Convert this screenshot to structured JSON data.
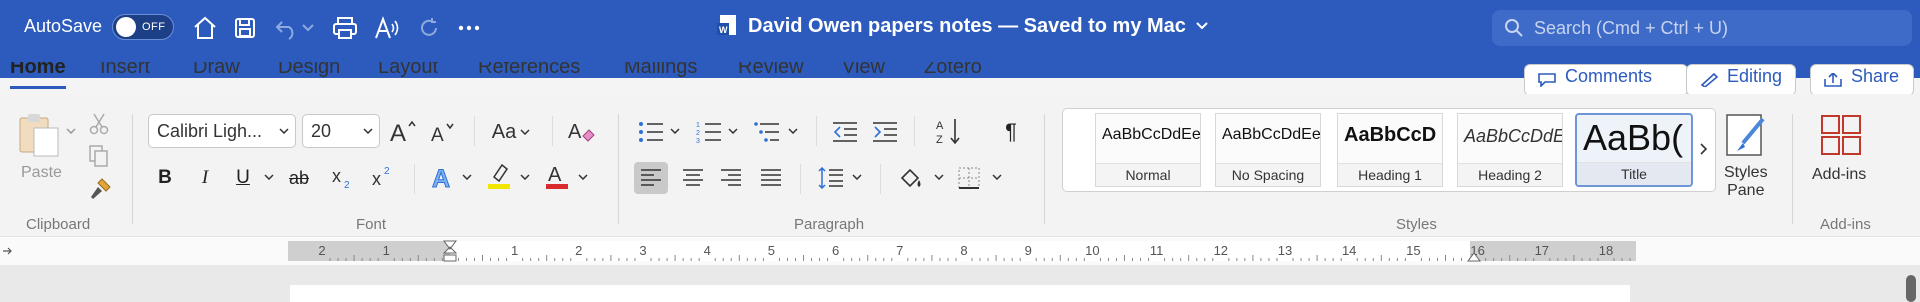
{
  "titlebar": {
    "autosave_label": "AutoSave",
    "autosave_state": "OFF",
    "document_title": "David Owen papers notes — Saved to my Mac",
    "search_placeholder": "Search (Cmd + Ctrl + U)",
    "icons": [
      "home-icon",
      "save-icon",
      "undo-icon",
      "print-icon",
      "read-aloud-icon",
      "redo-icon",
      "more-icon"
    ]
  },
  "tabs": [
    "Home",
    "Insert",
    "Draw",
    "Design",
    "Layout",
    "References",
    "Mailings",
    "Review",
    "View",
    "Zotero"
  ],
  "right_buttons": {
    "comments": "Comments",
    "editing": "Editing",
    "share": "Share"
  },
  "clipboard": {
    "paste": "Paste",
    "group": "Clipboard"
  },
  "font": {
    "family": "Calibri Ligh...",
    "size": "20",
    "group": "Font",
    "change_case": "Aa"
  },
  "paragraph": {
    "group": "Paragraph"
  },
  "styles": {
    "group": "Styles",
    "items": [
      {
        "sample": "AaBbCcDdEe",
        "name": "Normal"
      },
      {
        "sample": "AaBbCcDdEe",
        "name": "No Spacing"
      },
      {
        "sample": "AaBbCcD",
        "name": "Heading 1"
      },
      {
        "sample": "AaBbCcDdE",
        "name": "Heading 2"
      },
      {
        "sample": "AaBb(",
        "name": "Title"
      }
    ],
    "pane_line1": "Styles",
    "pane_line2": "Pane"
  },
  "addins": {
    "label": "Add-ins",
    "group": "Add-ins"
  },
  "ruler": {
    "labels": [
      "2",
      "1",
      "",
      "1",
      "2",
      "3",
      "4",
      "5",
      "6",
      "7",
      "8",
      "9",
      "10",
      "11",
      "12",
      "13",
      "14",
      "15",
      "16",
      "17",
      "18"
    ]
  },
  "colors": {
    "accent": "#2c5bbd",
    "highlight": "#f2e600",
    "font_color": "#d92b2b",
    "text_effect": "#2f6fd6",
    "addins_red": "#c0392b"
  }
}
